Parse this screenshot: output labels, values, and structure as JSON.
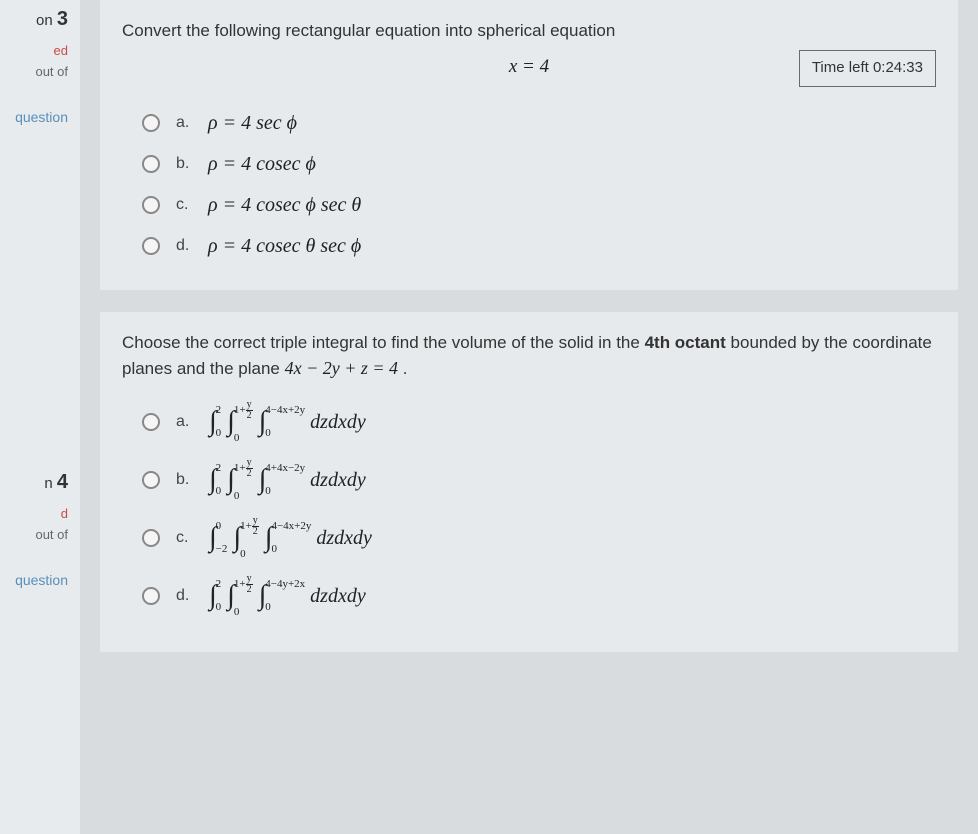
{
  "timer": {
    "label": "Time left 0:24:33"
  },
  "sidebar": {
    "q1": {
      "prefix": "on",
      "number": "3",
      "status": "ed",
      "outof": " out of",
      "flag": " question"
    },
    "q2": {
      "prefix": "n",
      "number": "4",
      "status": "d",
      "outof": "out of",
      "flag": "question"
    }
  },
  "question1": {
    "stem": "Convert the following rectangular equation into spherical equation",
    "equation": "x = 4",
    "options": {
      "a": {
        "label": "a.",
        "math": "ρ = 4 sec ϕ"
      },
      "b": {
        "label": "b.",
        "math": "ρ = 4 cosec ϕ"
      },
      "c": {
        "label": "c.",
        "math": "ρ = 4 cosec ϕ sec θ"
      },
      "d": {
        "label": "d.",
        "math": "ρ = 4 cosec θ sec ϕ"
      }
    }
  },
  "question2": {
    "stem_part1": "Choose the correct triple integral to find the volume of the solid in the ",
    "stem_bold": "4th octant",
    "stem_part2": " bounded by the coordinate planes and the plane ",
    "plane_eq": "4x − 2y + z = 4",
    "period": " .",
    "options": {
      "a": {
        "label": "a.",
        "y_lo": "0",
        "y_hi": "2",
        "x_lo": "0",
        "x_hi_base": "1+",
        "x_hi_num": "y",
        "x_hi_den": "2",
        "z_lo": "0",
        "z_hi": "4−4x+2y",
        "diff": "dzdxdy"
      },
      "b": {
        "label": "b.",
        "y_lo": "0",
        "y_hi": "2",
        "x_lo": "0",
        "x_hi_base": "1+",
        "x_hi_num": "y",
        "x_hi_den": "2",
        "z_lo": "0",
        "z_hi": "4+4x−2y",
        "diff": "dzdxdy"
      },
      "c": {
        "label": "c.",
        "y_lo": "−2",
        "y_hi": "0",
        "x_lo": "0",
        "x_hi_base": "1+",
        "x_hi_num": "y",
        "x_hi_den": "2",
        "z_lo": "0",
        "z_hi": "4−4x+2y",
        "diff": "dzdxdy"
      },
      "d": {
        "label": "d.",
        "y_lo": "0",
        "y_hi": "2",
        "x_lo": "0",
        "x_hi_base": "1+",
        "x_hi_num": "y",
        "x_hi_den": "2",
        "z_lo": "0",
        "z_hi": "4−4y+2x",
        "diff": "dzdxdy"
      }
    }
  }
}
